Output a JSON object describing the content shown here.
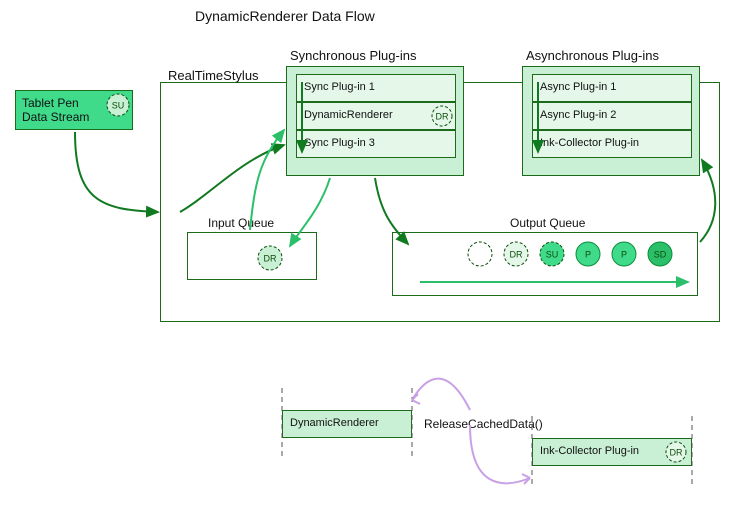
{
  "title": "DynamicRenderer Data Flow",
  "tabletPen": {
    "line1": "Tablet Pen",
    "line2": "Data Stream",
    "badge": "SU"
  },
  "rts": {
    "label": "RealTimeStylus"
  },
  "sync": {
    "heading": "Synchronous Plug-ins",
    "items": [
      "Sync Plug-in 1",
      "DynamicRenderer",
      "Sync Plug-in 3"
    ],
    "badge": "DR"
  },
  "async": {
    "heading": "Asynchronous Plug-ins",
    "items": [
      "Async Plug-in 1",
      "Async Plug-in 2",
      "Ink-Collector Plug-in"
    ]
  },
  "inputQueue": {
    "label": "Input Queue",
    "badge": "DR"
  },
  "outputQueue": {
    "label": "Output Queue",
    "circles": [
      "",
      "DR",
      "SU",
      "P",
      "P",
      "SD"
    ]
  },
  "bottom": {
    "left": "DynamicRenderer",
    "call": "ReleaseCachedData()",
    "right": "Ink-Collector Plug-in",
    "badge": "DR"
  },
  "colors": {
    "darkGreen": "#0f7a1f",
    "midGreen": "#2bbf6a",
    "lightGreen": "#c9f0d4",
    "paleGreen": "#e4f7e8",
    "brightGreen": "#3fda8a",
    "lilac": "#c9a0e6"
  }
}
